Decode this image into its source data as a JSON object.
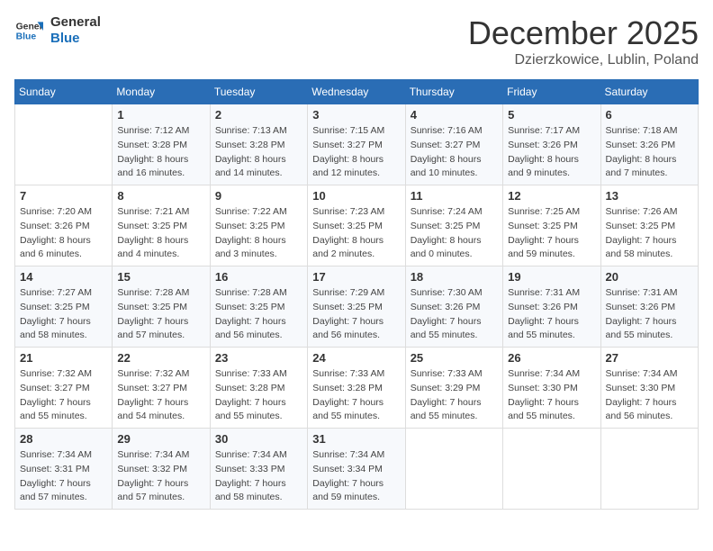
{
  "logo": {
    "line1": "General",
    "line2": "Blue"
  },
  "title": "December 2025",
  "subtitle": "Dzierzkowice, Lublin, Poland",
  "weekdays": [
    "Sunday",
    "Monday",
    "Tuesday",
    "Wednesday",
    "Thursday",
    "Friday",
    "Saturday"
  ],
  "weeks": [
    [
      {
        "day": "",
        "sunrise": "",
        "sunset": "",
        "daylight": ""
      },
      {
        "day": "1",
        "sunrise": "Sunrise: 7:12 AM",
        "sunset": "Sunset: 3:28 PM",
        "daylight": "Daylight: 8 hours and 16 minutes."
      },
      {
        "day": "2",
        "sunrise": "Sunrise: 7:13 AM",
        "sunset": "Sunset: 3:28 PM",
        "daylight": "Daylight: 8 hours and 14 minutes."
      },
      {
        "day": "3",
        "sunrise": "Sunrise: 7:15 AM",
        "sunset": "Sunset: 3:27 PM",
        "daylight": "Daylight: 8 hours and 12 minutes."
      },
      {
        "day": "4",
        "sunrise": "Sunrise: 7:16 AM",
        "sunset": "Sunset: 3:27 PM",
        "daylight": "Daylight: 8 hours and 10 minutes."
      },
      {
        "day": "5",
        "sunrise": "Sunrise: 7:17 AM",
        "sunset": "Sunset: 3:26 PM",
        "daylight": "Daylight: 8 hours and 9 minutes."
      },
      {
        "day": "6",
        "sunrise": "Sunrise: 7:18 AM",
        "sunset": "Sunset: 3:26 PM",
        "daylight": "Daylight: 8 hours and 7 minutes."
      }
    ],
    [
      {
        "day": "7",
        "sunrise": "Sunrise: 7:20 AM",
        "sunset": "Sunset: 3:26 PM",
        "daylight": "Daylight: 8 hours and 6 minutes."
      },
      {
        "day": "8",
        "sunrise": "Sunrise: 7:21 AM",
        "sunset": "Sunset: 3:25 PM",
        "daylight": "Daylight: 8 hours and 4 minutes."
      },
      {
        "day": "9",
        "sunrise": "Sunrise: 7:22 AM",
        "sunset": "Sunset: 3:25 PM",
        "daylight": "Daylight: 8 hours and 3 minutes."
      },
      {
        "day": "10",
        "sunrise": "Sunrise: 7:23 AM",
        "sunset": "Sunset: 3:25 PM",
        "daylight": "Daylight: 8 hours and 2 minutes."
      },
      {
        "day": "11",
        "sunrise": "Sunrise: 7:24 AM",
        "sunset": "Sunset: 3:25 PM",
        "daylight": "Daylight: 8 hours and 0 minutes."
      },
      {
        "day": "12",
        "sunrise": "Sunrise: 7:25 AM",
        "sunset": "Sunset: 3:25 PM",
        "daylight": "Daylight: 7 hours and 59 minutes."
      },
      {
        "day": "13",
        "sunrise": "Sunrise: 7:26 AM",
        "sunset": "Sunset: 3:25 PM",
        "daylight": "Daylight: 7 hours and 58 minutes."
      }
    ],
    [
      {
        "day": "14",
        "sunrise": "Sunrise: 7:27 AM",
        "sunset": "Sunset: 3:25 PM",
        "daylight": "Daylight: 7 hours and 58 minutes."
      },
      {
        "day": "15",
        "sunrise": "Sunrise: 7:28 AM",
        "sunset": "Sunset: 3:25 PM",
        "daylight": "Daylight: 7 hours and 57 minutes."
      },
      {
        "day": "16",
        "sunrise": "Sunrise: 7:28 AM",
        "sunset": "Sunset: 3:25 PM",
        "daylight": "Daylight: 7 hours and 56 minutes."
      },
      {
        "day": "17",
        "sunrise": "Sunrise: 7:29 AM",
        "sunset": "Sunset: 3:25 PM",
        "daylight": "Daylight: 7 hours and 56 minutes."
      },
      {
        "day": "18",
        "sunrise": "Sunrise: 7:30 AM",
        "sunset": "Sunset: 3:26 PM",
        "daylight": "Daylight: 7 hours and 55 minutes."
      },
      {
        "day": "19",
        "sunrise": "Sunrise: 7:31 AM",
        "sunset": "Sunset: 3:26 PM",
        "daylight": "Daylight: 7 hours and 55 minutes."
      },
      {
        "day": "20",
        "sunrise": "Sunrise: 7:31 AM",
        "sunset": "Sunset: 3:26 PM",
        "daylight": "Daylight: 7 hours and 55 minutes."
      }
    ],
    [
      {
        "day": "21",
        "sunrise": "Sunrise: 7:32 AM",
        "sunset": "Sunset: 3:27 PM",
        "daylight": "Daylight: 7 hours and 55 minutes."
      },
      {
        "day": "22",
        "sunrise": "Sunrise: 7:32 AM",
        "sunset": "Sunset: 3:27 PM",
        "daylight": "Daylight: 7 hours and 54 minutes."
      },
      {
        "day": "23",
        "sunrise": "Sunrise: 7:33 AM",
        "sunset": "Sunset: 3:28 PM",
        "daylight": "Daylight: 7 hours and 55 minutes."
      },
      {
        "day": "24",
        "sunrise": "Sunrise: 7:33 AM",
        "sunset": "Sunset: 3:28 PM",
        "daylight": "Daylight: 7 hours and 55 minutes."
      },
      {
        "day": "25",
        "sunrise": "Sunrise: 7:33 AM",
        "sunset": "Sunset: 3:29 PM",
        "daylight": "Daylight: 7 hours and 55 minutes."
      },
      {
        "day": "26",
        "sunrise": "Sunrise: 7:34 AM",
        "sunset": "Sunset: 3:30 PM",
        "daylight": "Daylight: 7 hours and 55 minutes."
      },
      {
        "day": "27",
        "sunrise": "Sunrise: 7:34 AM",
        "sunset": "Sunset: 3:30 PM",
        "daylight": "Daylight: 7 hours and 56 minutes."
      }
    ],
    [
      {
        "day": "28",
        "sunrise": "Sunrise: 7:34 AM",
        "sunset": "Sunset: 3:31 PM",
        "daylight": "Daylight: 7 hours and 57 minutes."
      },
      {
        "day": "29",
        "sunrise": "Sunrise: 7:34 AM",
        "sunset": "Sunset: 3:32 PM",
        "daylight": "Daylight: 7 hours and 57 minutes."
      },
      {
        "day": "30",
        "sunrise": "Sunrise: 7:34 AM",
        "sunset": "Sunset: 3:33 PM",
        "daylight": "Daylight: 7 hours and 58 minutes."
      },
      {
        "day": "31",
        "sunrise": "Sunrise: 7:34 AM",
        "sunset": "Sunset: 3:34 PM",
        "daylight": "Daylight: 7 hours and 59 minutes."
      },
      {
        "day": "",
        "sunrise": "",
        "sunset": "",
        "daylight": ""
      },
      {
        "day": "",
        "sunrise": "",
        "sunset": "",
        "daylight": ""
      },
      {
        "day": "",
        "sunrise": "",
        "sunset": "",
        "daylight": ""
      }
    ]
  ]
}
